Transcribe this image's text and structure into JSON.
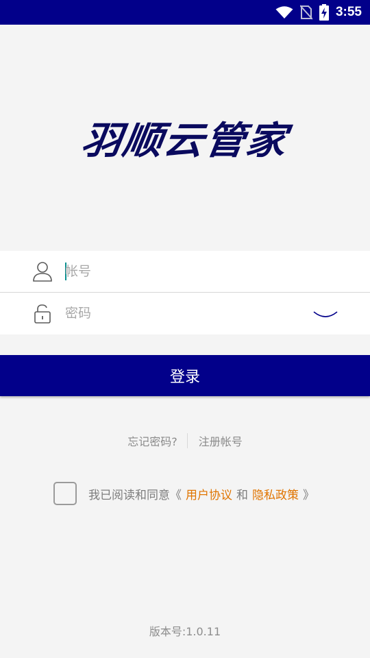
{
  "status_bar": {
    "time": "3:55",
    "icons": [
      "wifi-icon",
      "no-sim-icon",
      "battery-charging-icon"
    ],
    "background": "#02008a"
  },
  "app": {
    "logo_text": "羽顺云管家",
    "logo_color": "#0a0a5e"
  },
  "form": {
    "account_placeholder": "帐号",
    "account_value": "",
    "password_placeholder": "密码",
    "password_value": "",
    "account_icon": "user-icon",
    "password_icon": "lock-icon",
    "password_toggle_icon": "eye-closed-icon"
  },
  "login_button": {
    "label": "登录",
    "color": "#02008a"
  },
  "links": {
    "forgot_password": "忘记密码?",
    "register": "注册帐号"
  },
  "agreement": {
    "prefix": "我已阅读和同意《",
    "user_agreement": "用户协议",
    "and": "和",
    "privacy_policy": "隐私政策",
    "suffix": "》",
    "checked": false,
    "link_color": "#e07400"
  },
  "version": "版本号:1.0.11"
}
